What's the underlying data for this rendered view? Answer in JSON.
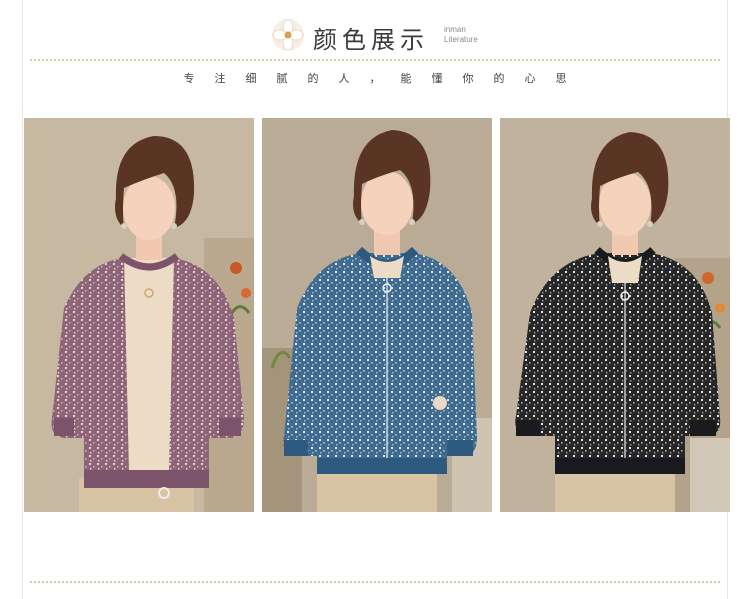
{
  "header": {
    "title_cn": "颜色展示",
    "title_en_line1": "inman",
    "title_en_line2": "Literature",
    "slogan": "专注细腻的人，能懂你的心思"
  },
  "colors": {
    "accent_rule": "#d9c9a6",
    "panels": [
      {
        "sweater": "#8d6478",
        "trim": "#7b536a",
        "background": "#c7b8a1"
      },
      {
        "sweater": "#3f6c94",
        "trim": "#2f5a80",
        "background": "#b9ab95"
      },
      {
        "sweater": "#26272b",
        "trim": "#1a1b1f",
        "background": "#c0b29d"
      }
    ]
  }
}
